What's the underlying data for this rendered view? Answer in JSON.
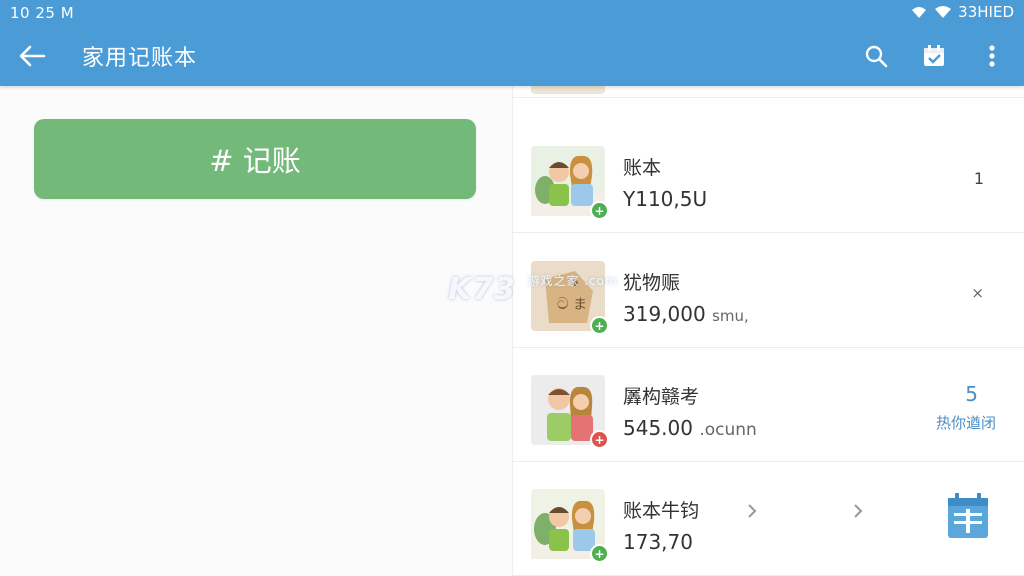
{
  "status_bar": {
    "time": "10 25 M",
    "right_text": "33HIED"
  },
  "app_bar": {
    "title": "家用记账本",
    "back_icon": "arrow-left-icon",
    "actions": [
      "search-icon",
      "calendar-check-icon",
      "more-vert-icon"
    ]
  },
  "record_button": {
    "label": "# 记账"
  },
  "accounts": [
    {
      "name": "账本",
      "amount": "Y110,5U",
      "unit": "",
      "right": "1",
      "badge": "+",
      "badge_color": "#4caf50"
    },
    {
      "name": "犹物赈",
      "amount": "319,000",
      "unit": "smu,",
      "right": "×",
      "badge": "+",
      "badge_color": "#4caf50"
    },
    {
      "name": "羼构赣考",
      "amount": "545.00",
      "unit": ".ocunn",
      "right_number": "5",
      "right_label": "热你遒闭",
      "badge": "+",
      "badge_color": "#d9534f"
    },
    {
      "name": "账本牛钧",
      "amount": "173,70",
      "unit": "",
      "badge": "+",
      "badge_color": "#4caf50"
    }
  ],
  "watermark": {
    "text": "K73",
    "sub": "游戏之家 .com"
  },
  "colors": {
    "primary": "#4a9bd6",
    "record_green": "#72b97a",
    "link_blue": "#4a8fc9"
  }
}
